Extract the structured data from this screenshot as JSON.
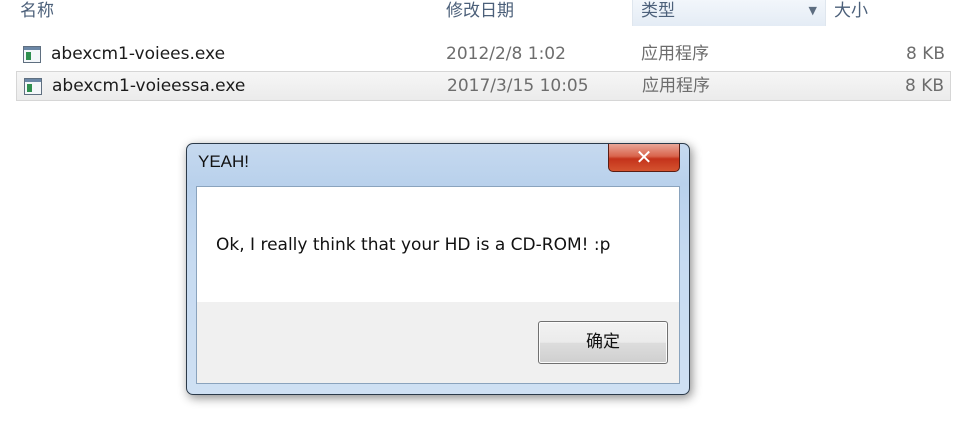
{
  "columns": {
    "name": "名称",
    "date_modified": "修改日期",
    "type": "类型",
    "size": "大小"
  },
  "files": [
    {
      "name": "abexcm1-voiees.exe",
      "date": "2012/2/8 1:02",
      "type": "应用程序",
      "size": "8 KB",
      "icon": "exe-file-icon"
    },
    {
      "name": "abexcm1-voieessa.exe",
      "date": "2017/3/15 10:05",
      "type": "应用程序",
      "size": "8 KB",
      "icon": "exe-file-icon",
      "selected": true
    }
  ],
  "dialog": {
    "title": "YEAH!",
    "message": "Ok, I really think that your HD is a CD-ROM! :p",
    "ok_label": "确定",
    "close_glyph": "✕"
  },
  "colors": {
    "close_button": "#c4331b",
    "dialog_frame": "#b9d1ec"
  }
}
